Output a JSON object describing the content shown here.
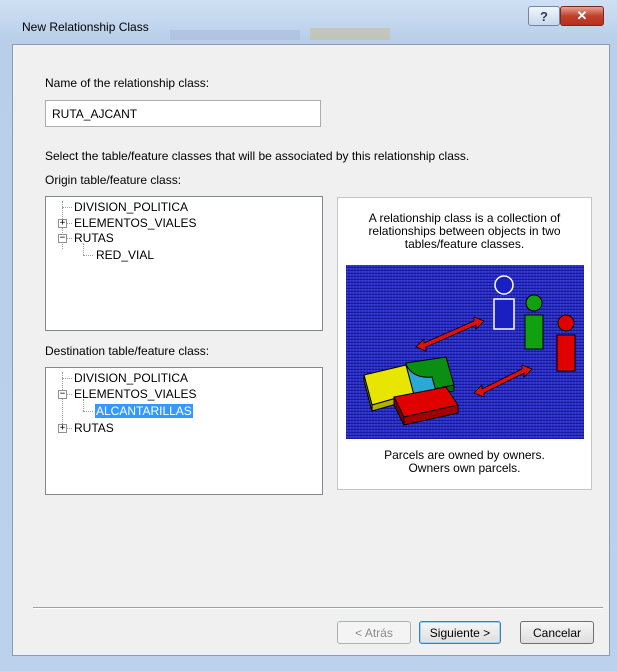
{
  "window": {
    "title": "New Relationship Class"
  },
  "form": {
    "name_label": "Name of the relationship class:",
    "name_value": "RUTA_AJCANT",
    "instruction": "Select the table/feature classes that will be associated by this relationship class.",
    "origin_label": "Origin table/feature class:",
    "destination_label": "Destination table/feature class:"
  },
  "origin_tree": [
    {
      "label": "DIVISION_POLITICA",
      "expander": ""
    },
    {
      "label": "ELEMENTOS_VIALES",
      "expander": "+"
    },
    {
      "label": "RUTAS",
      "expander": "−"
    },
    {
      "label": "RED_VIAL",
      "expander": ""
    }
  ],
  "destination_tree": [
    {
      "label": "DIVISION_POLITICA",
      "expander": ""
    },
    {
      "label": "ELEMENTOS_VIALES",
      "expander": "−"
    },
    {
      "label": "ALCANTARILLAS",
      "expander": "",
      "selected": true
    },
    {
      "label": "RUTAS",
      "expander": "+"
    }
  ],
  "info": {
    "line1": "A relationship class is a collection of",
    "line2": "relationships between objects in two",
    "line3": "tables/feature classes.",
    "caption1": "Parcels are owned by owners.",
    "caption2": "Owners own parcels."
  },
  "buttons": {
    "back": "< Atrás",
    "next": "Siguiente >",
    "cancel": "Cancelar"
  },
  "colors": {
    "accent_selection": "#3399ff",
    "art_background": "#1a1fbf"
  }
}
